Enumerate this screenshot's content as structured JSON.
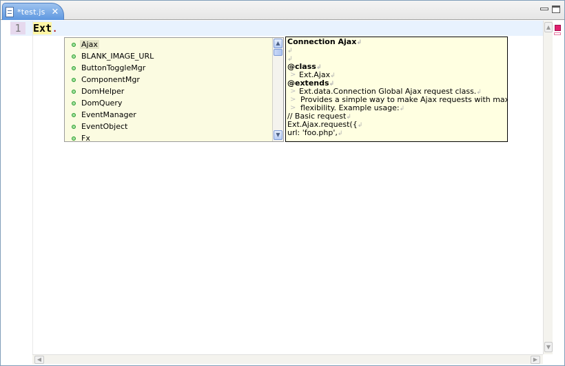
{
  "tab": {
    "label": "*test.js",
    "close_glyph": "✕",
    "icon": "js-file-icon"
  },
  "window_controls": {
    "minimize": "minimize-icon",
    "maximize": "maximize-icon"
  },
  "editor": {
    "line_number": "1",
    "code_keyword": "Ext",
    "code_dot": "."
  },
  "autocomplete": {
    "items": [
      {
        "label": "Ajax",
        "selected": true
      },
      {
        "label": "BLANK_IMAGE_URL"
      },
      {
        "label": "ButtonToggleMgr"
      },
      {
        "label": "ComponentMgr"
      },
      {
        "label": "DomHelper"
      },
      {
        "label": "DomQuery"
      },
      {
        "label": "EventManager"
      },
      {
        "label": "EventObject"
      },
      {
        "label": "Fx"
      }
    ],
    "scroll_up": "▲",
    "scroll_down": "▼"
  },
  "doc": {
    "title": "Connection Ajax",
    "lines": [
      {
        "text": "",
        "style": ""
      },
      {
        "text": "",
        "style": ""
      },
      {
        "text": "@class",
        "style": "b"
      },
      {
        "text": "Ext.Ajax",
        "style": "i1"
      },
      {
        "text": "@extends",
        "style": "b"
      },
      {
        "text": "Ext.data.Connection Global Ajax request class.",
        "style": "i1"
      },
      {
        "text": "Provides a simple way to make Ajax requests with maximu",
        "style": "i2"
      },
      {
        "text": "flexibility. Example usage:",
        "style": "i2"
      },
      {
        "text": "// Basic request",
        "style": ""
      },
      {
        "text": "Ext.Ajax.request({",
        "style": ""
      },
      {
        "text": "url: 'foo.php',",
        "style": ""
      }
    ],
    "line_end_mark": "↲",
    "quote_mark": ">"
  },
  "colors": {
    "tab_active": "#5d97e0",
    "doc_bg": "#ffffe1",
    "list_bg": "#fbfbe1",
    "error_marker": "#e0206e"
  }
}
